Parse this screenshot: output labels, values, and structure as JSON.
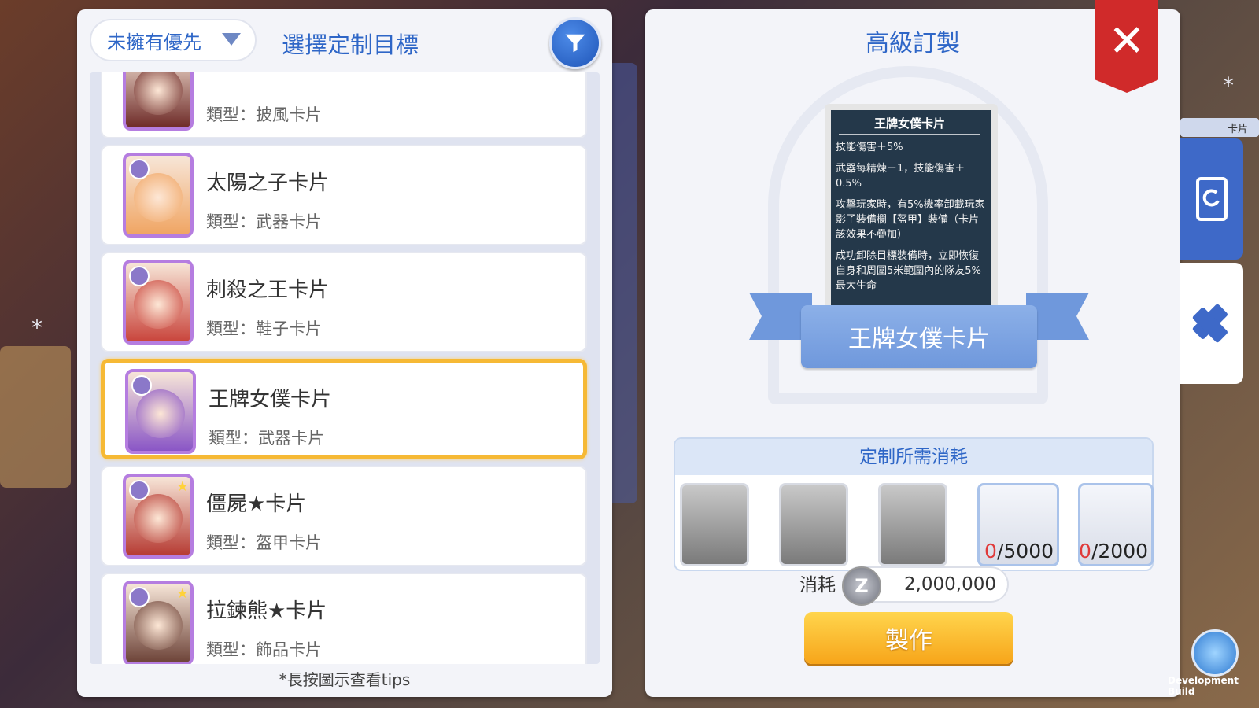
{
  "left": {
    "filter_label": "未擁有優先",
    "title": "選擇定制目標",
    "hint": "*長按圖示查看tips",
    "items": [
      {
        "name": "",
        "type": "類型：披風卡片",
        "color": "#6e2b28"
      },
      {
        "name": "太陽之子卡片",
        "type": "類型：武器卡片",
        "color": "#f0a563"
      },
      {
        "name": "刺殺之王卡片",
        "type": "類型：鞋子卡片",
        "color": "#c9453c"
      },
      {
        "name": "王牌女僕卡片",
        "type": "類型：武器卡片",
        "color": "#8a56c6"
      },
      {
        "name": "僵屍★卡片",
        "type": "類型：盔甲卡片",
        "color": "#b63b33"
      },
      {
        "name": "拉鍊熊★卡片",
        "type": "類型：飾品卡片",
        "color": "#6d4338"
      }
    ],
    "selected_index": 3
  },
  "right": {
    "title": "高級訂製",
    "card": {
      "title": "王牌女僕卡片",
      "lines": [
        "技能傷害＋5%",
        "武器每精煉＋1，技能傷害＋0.5%",
        "攻擊玩家時，有5%機率卸載玩家影子裝備欄【盔甲】裝備（卡片該效果不疊加）",
        "成功卸除目標裝備時，立即恢復自身和周圍5米範圍內的隊友5%最大生命"
      ]
    },
    "ribbon_label": "王牌女僕卡片",
    "materials_title": "定制所需消耗",
    "materials": [
      {
        "icon": "wolf-card-icon",
        "have": "",
        "need": ""
      },
      {
        "icon": "armor-card-icon",
        "have": "",
        "need": ""
      },
      {
        "icon": "flower-card-icon",
        "have": "",
        "need": ""
      },
      {
        "icon": "crystal-shard-icon",
        "have": "0",
        "need": "/5000"
      },
      {
        "icon": "dust-icon",
        "have": "0",
        "need": "/2000"
      }
    ],
    "cost_label": "消耗",
    "cost_value": "2,000,000",
    "make_label": "製作"
  },
  "side": {
    "top_label": "卡片"
  },
  "footer": {
    "build": "Development Build"
  }
}
